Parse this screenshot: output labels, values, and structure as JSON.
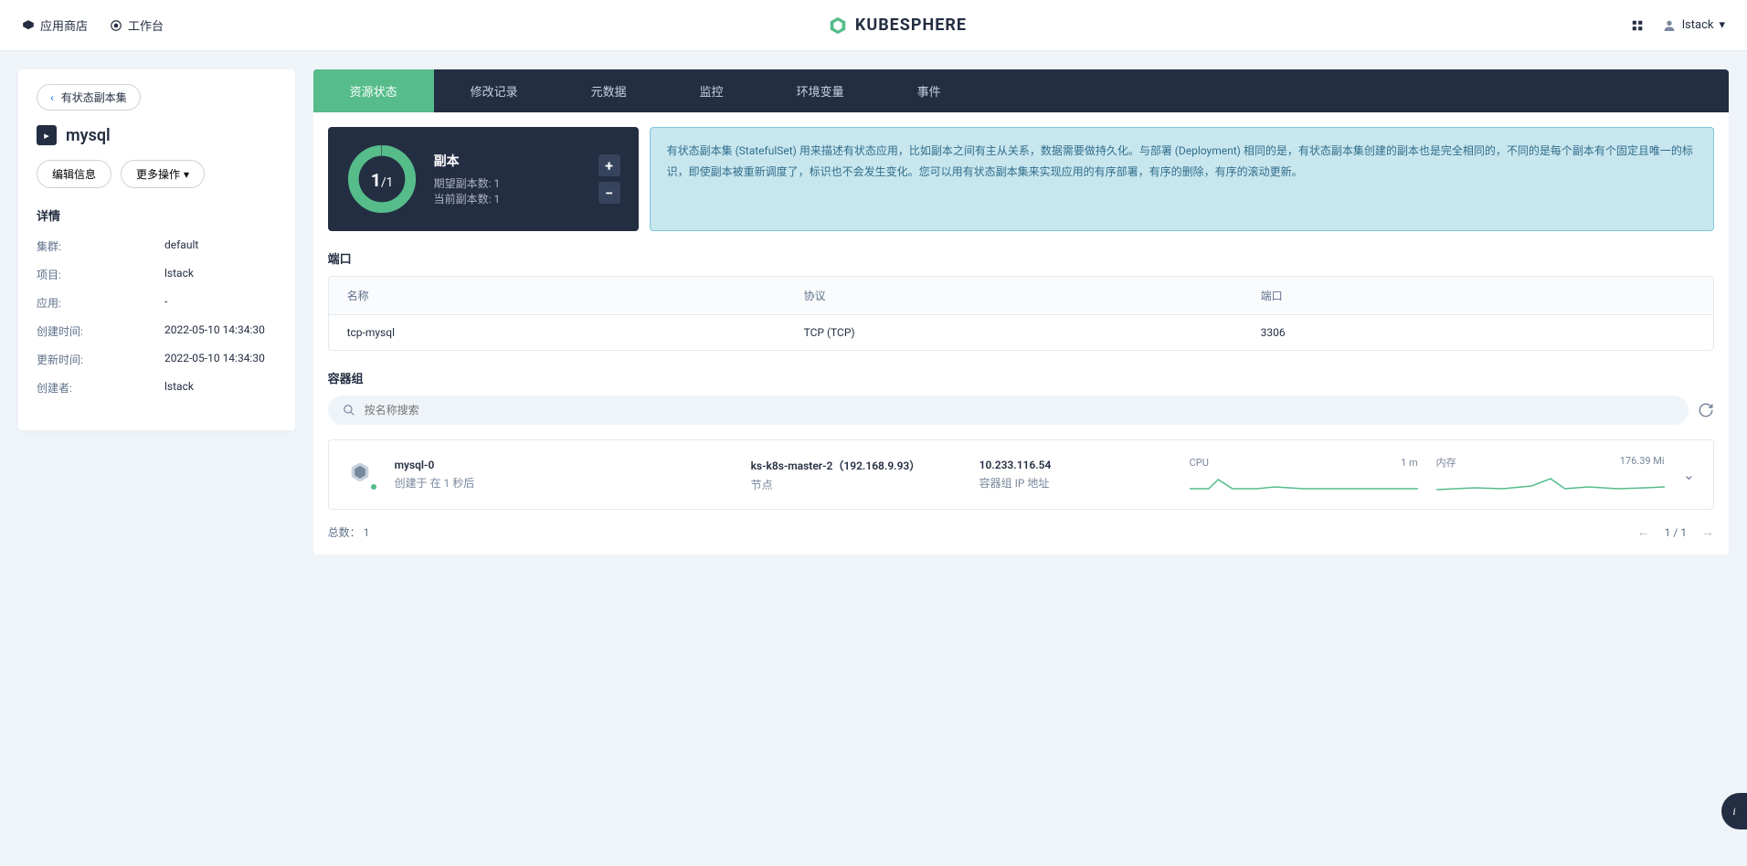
{
  "topbar": {
    "app_store": "应用商店",
    "workspace": "工作台",
    "brand": "KUBESPHERE",
    "username": "lstack"
  },
  "sidebar": {
    "back_label": "有状态副本集",
    "title": "mysql",
    "edit_btn": "编辑信息",
    "more_btn": "更多操作",
    "details_header": "详情",
    "rows": [
      {
        "label": "集群:",
        "value": "default"
      },
      {
        "label": "项目:",
        "value": "lstack"
      },
      {
        "label": "应用:",
        "value": "-"
      },
      {
        "label": "创建时间:",
        "value": "2022-05-10 14:34:30"
      },
      {
        "label": "更新时间:",
        "value": "2022-05-10 14:34:30"
      },
      {
        "label": "创建者:",
        "value": "lstack"
      }
    ]
  },
  "tabs": [
    "资源状态",
    "修改记录",
    "元数据",
    "监控",
    "环境变量",
    "事件"
  ],
  "replica": {
    "title": "副本",
    "ratio_cur": "1",
    "ratio_total": "/1",
    "desired": "期望副本数: 1",
    "current": "当前副本数: 1"
  },
  "info_text": "有状态副本集 (StatefulSet) 用来描述有状态应用，比如副本之间有主从关系，数据需要做持久化。与部署 (Deployment) 相同的是，有状态副本集创建的副本也是完全相同的，不同的是每个副本有个固定且唯一的标识，即使副本被重新调度了，标识也不会发生变化。您可以用有状态副本集来实现应用的有序部署，有序的删除，有序的滚动更新。",
  "ports": {
    "section": "端口",
    "headers": {
      "name": "名称",
      "protocol": "协议",
      "port": "端口"
    },
    "rows": [
      {
        "name": "tcp-mysql",
        "protocol": "TCP (TCP)",
        "port": "3306"
      }
    ]
  },
  "pods": {
    "section": "容器组",
    "search_placeholder": "按名称搜索",
    "item": {
      "name": "mysql-0",
      "created": "创建于 在 1 秒后",
      "node": "ks-k8s-master-2（192.168.9.93）",
      "node_label": "节点",
      "ip": "10.233.116.54",
      "ip_label": "容器组 IP 地址",
      "cpu_label": "CPU",
      "cpu_value": "1 m",
      "mem_label": "内存",
      "mem_value": "176.39 Mi"
    },
    "total_label": "总数：",
    "total_value": "1",
    "page": "1 / 1"
  }
}
